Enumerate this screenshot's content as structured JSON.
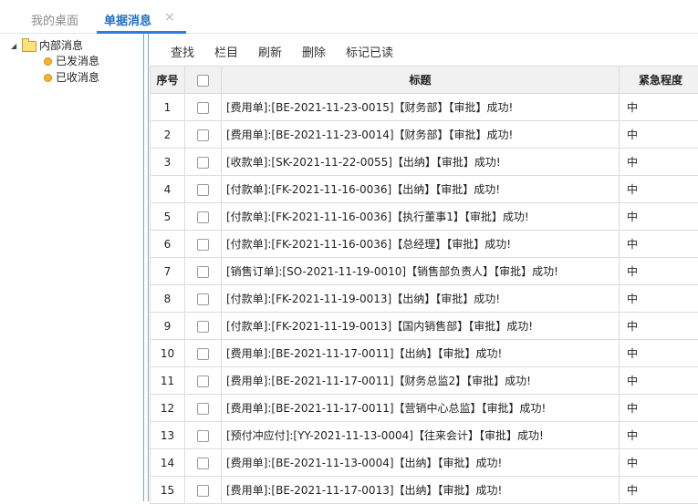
{
  "tabs": [
    {
      "label": "我的桌面",
      "active": false
    },
    {
      "label": "单据消息",
      "active": true
    }
  ],
  "tab_close_icon": "×",
  "tree": {
    "root": "内部消息",
    "children": [
      "已发消息",
      "已收消息"
    ]
  },
  "toolbar": [
    "查找",
    "栏目",
    "刷新",
    "删除",
    "标记已读"
  ],
  "table": {
    "headers": {
      "num": "序号",
      "title": "标题",
      "urgency": "紧急程度"
    },
    "rows": [
      {
        "num": "1",
        "title": "[费用单]:[BE-2021-11-23-0015]【财务部】【审批】成功!",
        "urgency": "中"
      },
      {
        "num": "2",
        "title": "[费用单]:[BE-2021-11-23-0014]【财务部】【审批】成功!",
        "urgency": "中"
      },
      {
        "num": "3",
        "title": "[收款单]:[SK-2021-11-22-0055]【出纳】【审批】成功!",
        "urgency": "中"
      },
      {
        "num": "4",
        "title": "[付款单]:[FK-2021-11-16-0036]【出纳】【审批】成功!",
        "urgency": "中"
      },
      {
        "num": "5",
        "title": "[付款单]:[FK-2021-11-16-0036]【执行董事1】【审批】成功!",
        "urgency": "中"
      },
      {
        "num": "6",
        "title": "[付款单]:[FK-2021-11-16-0036]【总经理】【审批】成功!",
        "urgency": "中"
      },
      {
        "num": "7",
        "title": "[销售订单]:[SO-2021-11-19-0010]【销售部负责人】【审批】成功!",
        "urgency": "中"
      },
      {
        "num": "8",
        "title": "[付款单]:[FK-2021-11-19-0013]【出纳】【审批】成功!",
        "urgency": "中"
      },
      {
        "num": "9",
        "title": "[付款单]:[FK-2021-11-19-0013]【国内销售部】【审批】成功!",
        "urgency": "中"
      },
      {
        "num": "10",
        "title": "[费用单]:[BE-2021-11-17-0011]【出纳】【审批】成功!",
        "urgency": "中"
      },
      {
        "num": "11",
        "title": "[费用单]:[BE-2021-11-17-0011]【财务总监2】【审批】成功!",
        "urgency": "中"
      },
      {
        "num": "12",
        "title": "[费用单]:[BE-2021-11-17-0011]【营销中心总监】【审批】成功!",
        "urgency": "中"
      },
      {
        "num": "13",
        "title": "[预付冲应付]:[YY-2021-11-13-0004]【往来会计】【审批】成功!",
        "urgency": "中"
      },
      {
        "num": "14",
        "title": "[费用单]:[BE-2021-11-13-0004]【出纳】【审批】成功!",
        "urgency": "中"
      },
      {
        "num": "15",
        "title": "[费用单]:[BE-2021-11-17-0013]【出纳】【审批】成功!",
        "urgency": "中"
      }
    ]
  }
}
